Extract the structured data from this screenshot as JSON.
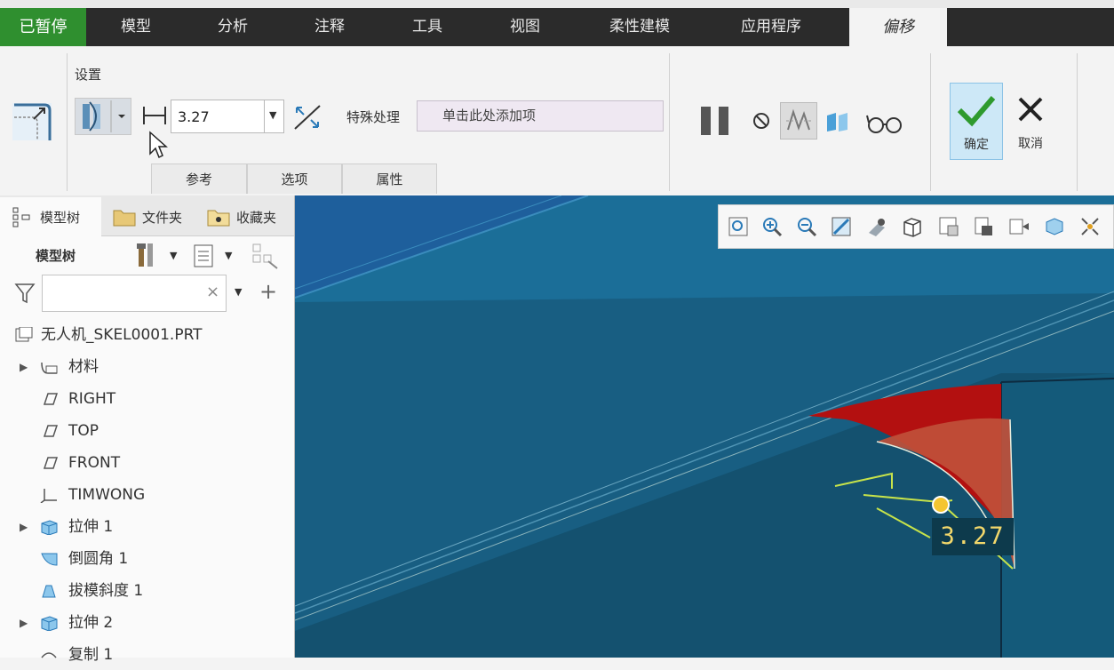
{
  "status": {
    "paused_label": "已暂停"
  },
  "menu": {
    "tabs": [
      "模型",
      "分析",
      "注释",
      "工具",
      "视图",
      "柔性建模",
      "应用程序"
    ],
    "active_tab": "偏移"
  },
  "ribbon": {
    "settings_label": "设置",
    "distance_value": "3.27",
    "special_label": "特殊处理",
    "special_placeholder": "单击此处添加项",
    "subtabs": [
      "参考",
      "选项",
      "属性"
    ],
    "ok_label": "确定",
    "cancel_label": "取消"
  },
  "left_panel": {
    "tabs": [
      "模型树",
      "文件夹",
      "收藏夹"
    ],
    "tree_title": "模型树",
    "filter_value": "",
    "root": "无人机_SKEL0001.PRT",
    "items": [
      {
        "label": "材料",
        "expandable": true,
        "icon": "material-icon"
      },
      {
        "label": "RIGHT",
        "expandable": false,
        "icon": "datum-plane-icon"
      },
      {
        "label": "TOP",
        "expandable": false,
        "icon": "datum-plane-icon"
      },
      {
        "label": "FRONT",
        "expandable": false,
        "icon": "datum-plane-icon"
      },
      {
        "label": "TIMWONG",
        "expandable": false,
        "icon": "csys-icon"
      },
      {
        "label": "拉伸 1",
        "expandable": true,
        "icon": "extrude-icon"
      },
      {
        "label": "倒圆角 1",
        "expandable": false,
        "icon": "round-icon"
      },
      {
        "label": "拔模斜度 1",
        "expandable": false,
        "icon": "draft-icon"
      },
      {
        "label": "拉伸 2",
        "expandable": true,
        "icon": "extrude-icon"
      },
      {
        "label": "复制 1",
        "expandable": false,
        "icon": "copy-icon"
      }
    ]
  },
  "viewport": {
    "dimension_label": "3.27"
  },
  "colors": {
    "menubar": "#2b2b2b",
    "paused_green": "#2f8f2f",
    "viewport_blue": "#1a6f9a",
    "surface_red": "#b31010",
    "ok_highlight": "#cde8f7"
  }
}
